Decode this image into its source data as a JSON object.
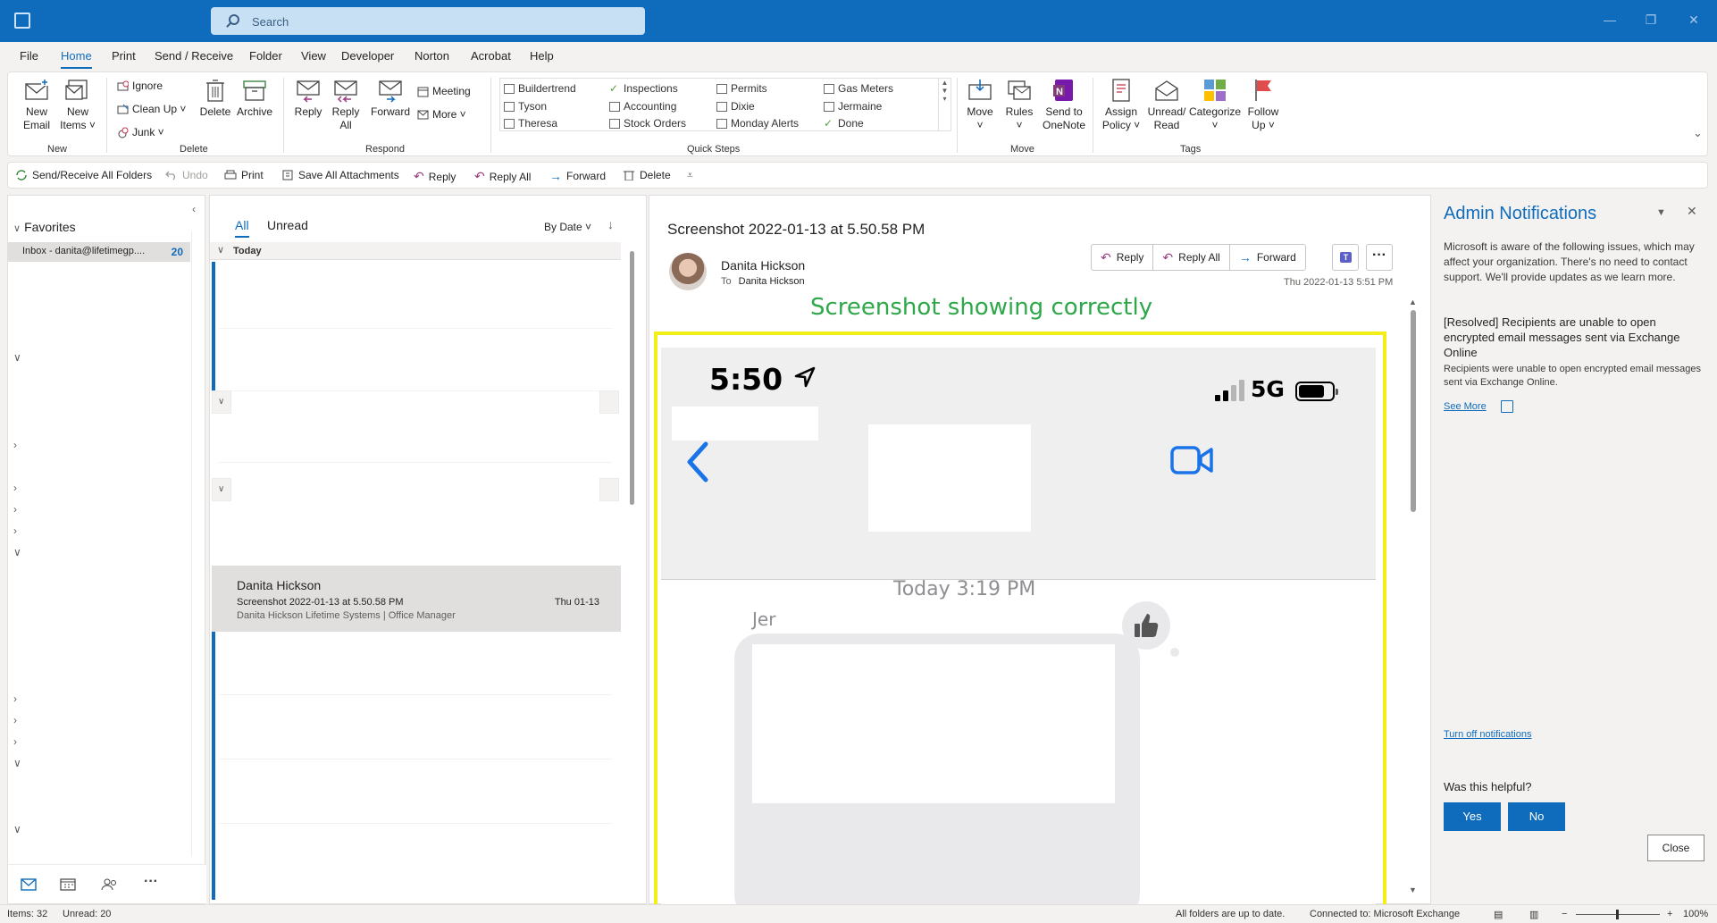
{
  "search": {
    "placeholder": "Search"
  },
  "menu": {
    "tabs": [
      "File",
      "Home",
      "Print",
      "Send / Receive",
      "Folder",
      "View",
      "Developer",
      "Norton",
      "Acrobat",
      "Help"
    ],
    "active": "Home"
  },
  "ribbon": {
    "new_group": {
      "label": "New",
      "new_email": "New\nEmail",
      "new_items": "New\nItems ˅"
    },
    "delete_group": {
      "label": "Delete",
      "ignore": "Ignore",
      "clean_up": "Clean Up ˅",
      "junk": "Junk ˅",
      "delete": "Delete",
      "archive": "Archive"
    },
    "respond_group": {
      "label": "Respond",
      "reply": "Reply",
      "reply_all": "Reply\nAll",
      "forward": "Forward",
      "meeting": "Meeting",
      "more": "More ˅"
    },
    "quick_steps": {
      "label": "Quick Steps",
      "items": [
        "Buildertrend",
        "Inspections",
        "Permits",
        "Gas Meters",
        "Tyson",
        "Accounting",
        "Dixie",
        "Jermaine",
        "Theresa",
        "Stock Orders",
        "Monday Alerts",
        "Done"
      ]
    },
    "move_group": {
      "label": "Move",
      "move": "Move\n˅",
      "rules": "Rules\n˅",
      "onenote": "Send to\nOneNote"
    },
    "tags_group": {
      "label": "Tags",
      "assign_policy": "Assign\nPolicy ˅",
      "unread_read": "Unread/\nRead",
      "categorize": "Categorize\n˅",
      "follow_up": "Follow\nUp ˅"
    }
  },
  "toolbar": {
    "send_receive_all": "Send/Receive All Folders",
    "undo": "Undo",
    "print": "Print",
    "save_all_attachments": "Save All Attachments",
    "reply": "Reply",
    "reply_all": "Reply All",
    "forward": "Forward",
    "delete": "Delete"
  },
  "folders": {
    "favorites": "Favorites",
    "inbox_label": "Inbox - danita@lifetimegp....",
    "inbox_count": "20"
  },
  "message_list": {
    "tab_all": "All",
    "tab_unread": "Unread",
    "sort": "By Date ˅",
    "group_today": "Today",
    "selected": {
      "from": "Danita Hickson",
      "subject": "Screenshot 2022-01-13 at 5.50.58 PM",
      "date": "Thu 01-13",
      "preview": "Danita Hickson  Lifetime Systems  |  Office Manager"
    }
  },
  "reading": {
    "subject": "Screenshot 2022-01-13 at 5.50.58 PM",
    "from": "Danita Hickson",
    "to_label": "To",
    "to": "Danita Hickson",
    "date": "Thu 2022-01-13 5:51 PM",
    "reply": "Reply",
    "reply_all": "Reply All",
    "forward": "Forward",
    "annotation": "Screenshot showing correctly",
    "phone": {
      "time": "5:50",
      "network": "5G",
      "today": "Today 3:19 PM",
      "sender": "Jer"
    }
  },
  "admin": {
    "title": "Admin Notifications",
    "intro": "Microsoft is aware of the following issues, which may affect your organization. There's no need to contact support. We'll provide updates as we learn more.",
    "issue": "[Resolved] Recipients are unable to open encrypted email messages sent via Exchange Online",
    "desc": "Recipients were unable to open encrypted email messages sent via Exchange Online.",
    "see_more": "See More",
    "turn_off": "Turn off notifications",
    "helpful": "Was this helpful?",
    "yes": "Yes",
    "no": "No",
    "close": "Close"
  },
  "status": {
    "items": "Items: 32",
    "unread": "Unread: 20",
    "sync": "All folders are up to date.",
    "connection": "Connected to: Microsoft Exchange",
    "zoom": "100%"
  },
  "colors": {
    "accent": "#0f6cbd",
    "annotation": "#2ea84a",
    "highlight": "#f4ee18"
  }
}
